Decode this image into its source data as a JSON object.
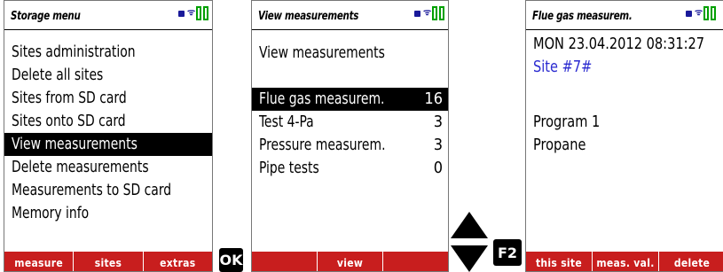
{
  "screen1": {
    "title": "Storage menu",
    "items": [
      "Sites administration",
      "Delete all sites",
      "Sites from SD card",
      "Sites onto SD card",
      "View measurements",
      "Delete measurements",
      "Measurements to SD card",
      "Memory info"
    ],
    "selected_index": 4,
    "footer": [
      "measure",
      "sites",
      "extras"
    ]
  },
  "key_ok": "OK",
  "screen2": {
    "title": "View measurements",
    "heading": "View measurements",
    "items": [
      {
        "label": "Flue gas measurem.",
        "count": "16"
      },
      {
        "label": "Test 4-Pa",
        "count": "3"
      },
      {
        "label": "Pressure measurem.",
        "count": "3"
      },
      {
        "label": "Pipe tests",
        "count": "0"
      }
    ],
    "selected_index": 0,
    "footer": [
      "",
      "view",
      ""
    ]
  },
  "key_f2": "F2",
  "screen3": {
    "title": "Flue gas measurem.",
    "datetime": "MON  23.04.2012  08:31:27",
    "site": "Site #7#",
    "program": "Program 1",
    "fuel": "Propane",
    "footer": [
      "this site",
      "meas. val.",
      "delete"
    ]
  },
  "colors": {
    "footer": "#c81e1e",
    "status_icon": "#1a1a9a",
    "battery": "#00a000",
    "site_text": "#2a2ad0"
  },
  "icons": [
    "plug-icon",
    "antenna-icon",
    "battery-icon",
    "arrow-up-icon",
    "arrow-down-icon"
  ]
}
